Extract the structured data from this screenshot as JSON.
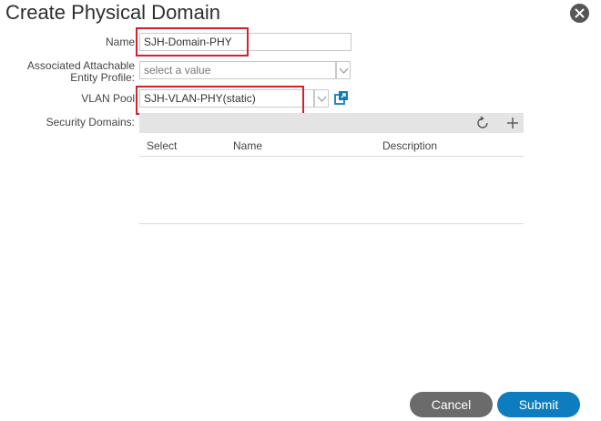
{
  "dialog": {
    "title": "Create Physical Domain"
  },
  "form": {
    "name_label": "Name",
    "name_value": "SJH-Domain-PHY",
    "aaep_label_line1": "Associated Attachable",
    "aaep_label_line2": "Entity Profile:",
    "aaep_placeholder": "select a value",
    "vlan_pool_label": "VLAN Pool",
    "vlan_pool_value": "SJH-VLAN-PHY(static)",
    "security_domains_label": "Security Domains:"
  },
  "security_table": {
    "columns": [
      "Select",
      "Name",
      "Description"
    ]
  },
  "buttons": {
    "cancel": "Cancel",
    "submit": "Submit"
  },
  "colors": {
    "highlight": "#d7202b",
    "submit": "#0e7dbf",
    "cancel": "#6b6b6b",
    "link_icon": "#0e7dbf"
  },
  "icons": {
    "close": "close-icon",
    "dropdown": "chevron-down-icon",
    "open_link": "external-link-icon",
    "refresh": "refresh-icon",
    "add": "plus-icon"
  }
}
